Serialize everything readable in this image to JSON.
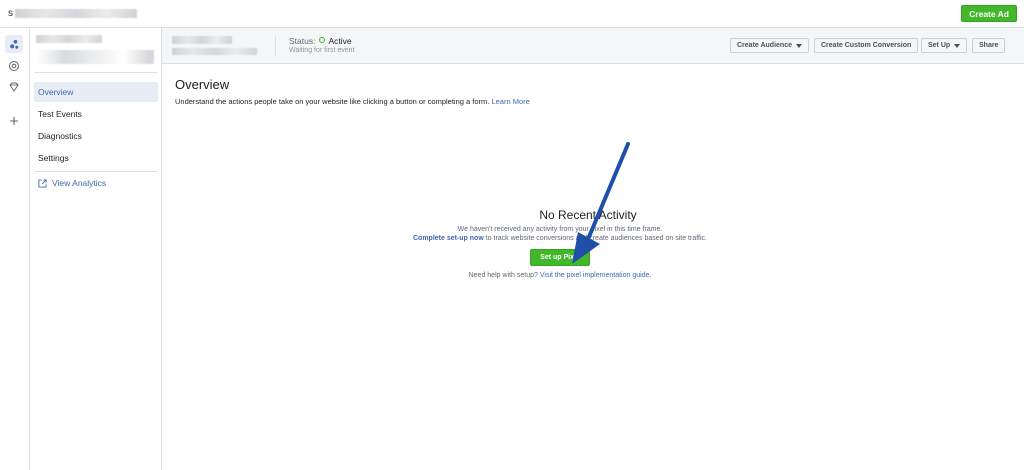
{
  "topbar": {
    "account_initial": "s",
    "create_ad_label": "Create Ad"
  },
  "side_nav": {
    "items": [
      {
        "label": "Overview",
        "active": true
      },
      {
        "label": "Test Events"
      },
      {
        "label": "Diagnostics"
      },
      {
        "label": "Settings"
      }
    ],
    "analytics_label": "View Analytics"
  },
  "header": {
    "status_label": "Status:",
    "status_value": "Active",
    "status_sub": "Waiting for first event",
    "buttons": {
      "create_audience": "Create Audience",
      "create_conversion": "Create Custom Conversion",
      "set_up": "Set Up",
      "share": "Share"
    }
  },
  "overview": {
    "title": "Overview",
    "description": "Understand the actions people take on your website like clicking a button or completing a form.",
    "learn_more": "Learn More"
  },
  "empty_state": {
    "title": "No Recent Activity",
    "line1": "We haven't received any activity from your pixel in this time frame.",
    "line2_link": "Complete set-up now",
    "line2_rest": "to track website conversions and create audiences based on site traffic.",
    "button_label": "Set up Pixel",
    "help_prefix": "Need help with setup?",
    "help_link": "Visit the pixel implementation guide."
  },
  "colors": {
    "accent": "#4267b2",
    "green": "#42b72a",
    "arrow": "#1f4fa8"
  }
}
